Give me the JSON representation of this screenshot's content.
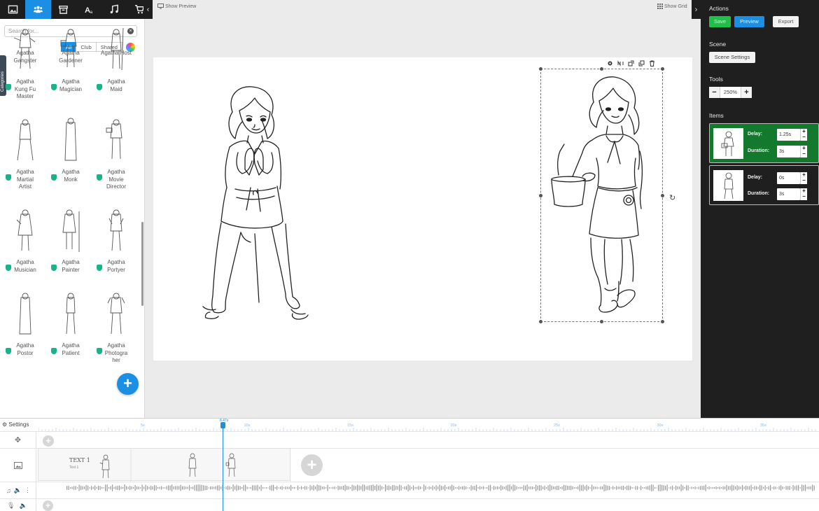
{
  "tabs": [
    {
      "name": "image-icon"
    },
    {
      "name": "characters-icon",
      "active": true
    },
    {
      "name": "store-icon"
    },
    {
      "name": "text-icon"
    },
    {
      "name": "music-icon"
    },
    {
      "name": "cart-icon"
    }
  ],
  "left_panel": {
    "search_placeholder": "Search for...",
    "filters": [
      "All",
      "Club",
      "Shared"
    ],
    "active_filter": "All",
    "categories_tab": "Categories",
    "partial_top": [
      "Agatha Gangster",
      "Agatha Gardener",
      "Agatha Host"
    ],
    "assets": [
      {
        "line1": "Agatha",
        "line2": "Kung Fu",
        "line3": "Master"
      },
      {
        "line1": "Agatha",
        "line2": "Magician",
        "line3": ""
      },
      {
        "line1": "Agatha",
        "line2": "Maid",
        "line3": ""
      },
      {
        "line1": "Agatha",
        "line2": "Martial",
        "line3": "Artist"
      },
      {
        "line1": "Agatha",
        "line2": "Monk",
        "line3": ""
      },
      {
        "line1": "Agatha",
        "line2": "Movie",
        "line3": "Director"
      },
      {
        "line1": "Agatha",
        "line2": "Musician",
        "line3": ""
      },
      {
        "line1": "Agatha",
        "line2": "Painter",
        "line3": ""
      },
      {
        "line1": "Agatha",
        "line2": "Portyer",
        "line3": ""
      },
      {
        "line1": "Agatha",
        "line2": "Postor",
        "line3": ""
      },
      {
        "line1": "Agatha",
        "line2": "Patient",
        "line3": ""
      },
      {
        "line1": "Agatha",
        "line2": "Photogra",
        "line3": "her"
      }
    ]
  },
  "stage": {
    "show_preview": "Show Preview",
    "show_grid": "Show Grid"
  },
  "right_panel": {
    "actions_title": "Actions",
    "save": "Save",
    "preview": "Preview",
    "export": "Export",
    "scene_title": "Scene",
    "scene_settings": "Scene Settings",
    "tools_title": "Tools",
    "zoom_value": "250%",
    "items_title": "Items",
    "items": [
      {
        "delay_label": "Delay:",
        "delay": "1.25s",
        "duration_label": "Duration:",
        "duration": "3s"
      },
      {
        "delay_label": "Delay:",
        "delay": "0s",
        "duration_label": "Duration:",
        "duration": "3s"
      }
    ]
  },
  "timeline": {
    "settings": "Settings",
    "playhead": "8.47s",
    "ticks": [
      "5s",
      "10s",
      "15s",
      "20s",
      "25s",
      "30s",
      "35s"
    ],
    "clip_text": "TEXT 1",
    "clip_subtext": "Text 1"
  },
  "colors": {
    "accent": "#1a8fe3",
    "save_green": "#1fbf4a",
    "selected_item": "#137a2d",
    "panel_dark": "#1f1f1f"
  }
}
